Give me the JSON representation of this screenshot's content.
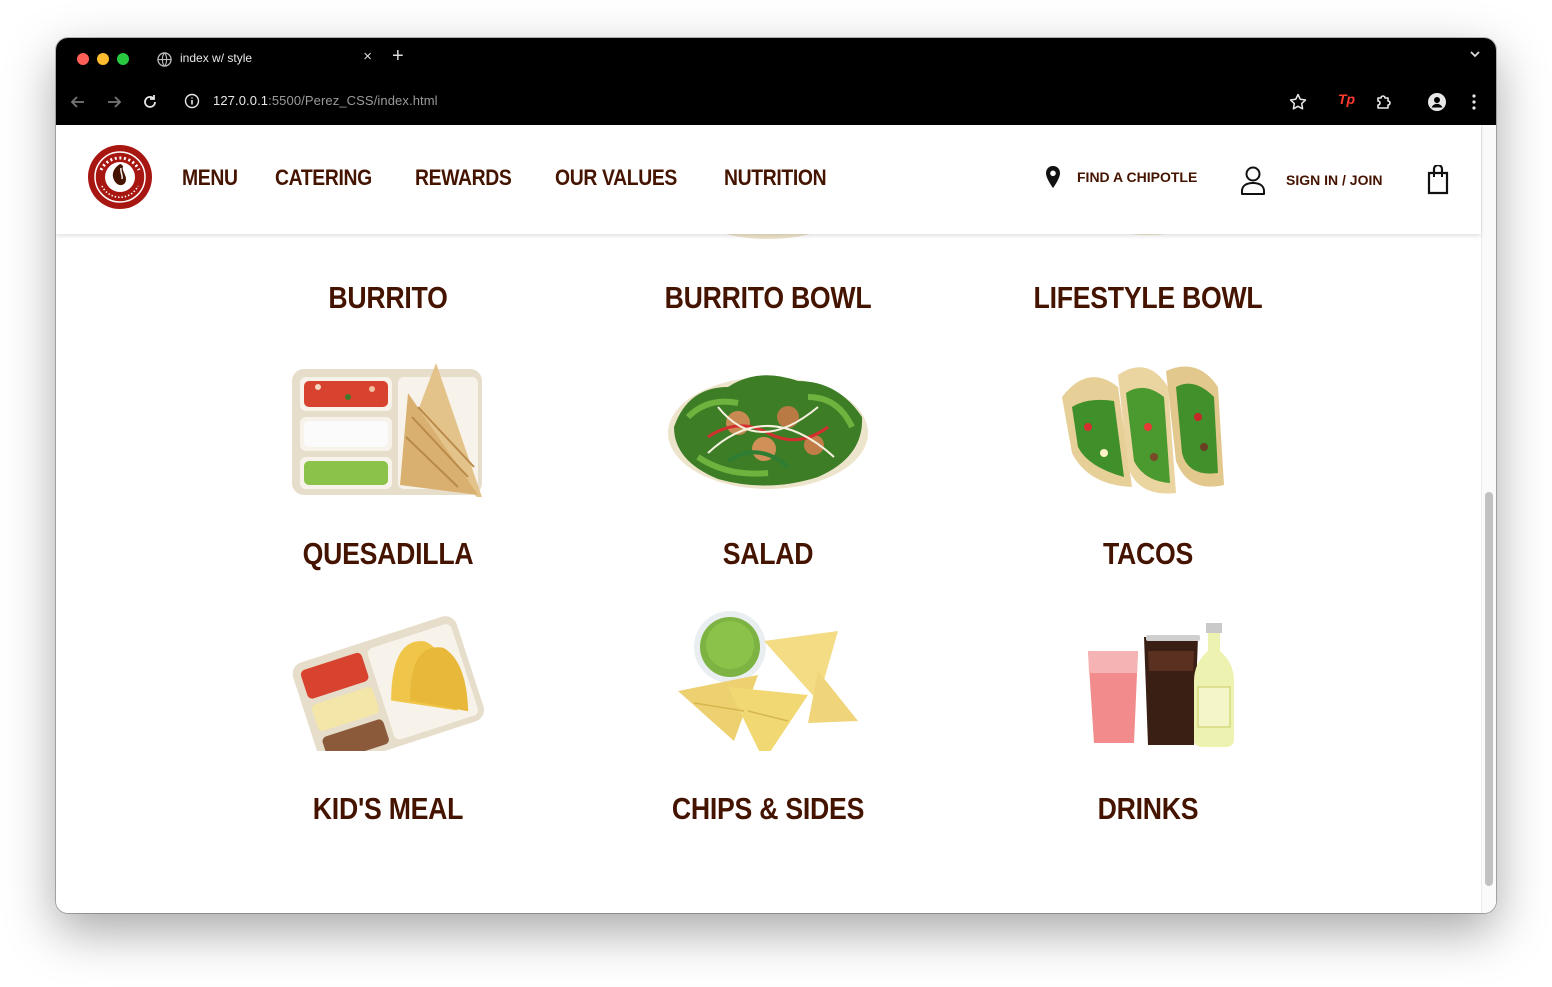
{
  "browser": {
    "tab_title": "index w/ style",
    "new_tab": "+",
    "close_tab": "×",
    "url_host": "127.0.0.1",
    "url_rest": ":5500/Perez_CSS/index.html",
    "extension_label": "Tp"
  },
  "header": {
    "nav": [
      "MENU",
      "CATERING",
      "REWARDS",
      "OUR VALUES",
      "NUTRITION"
    ],
    "find_label": "FIND A CHIPOTLE",
    "signin_label": "SIGN IN / JOIN"
  },
  "menu_items": [
    {
      "name": "BURRITO",
      "icon": "burrito-image"
    },
    {
      "name": "BURRITO BOWL",
      "icon": "burrito-bowl-image"
    },
    {
      "name": "LIFESTYLE BOWL",
      "icon": "lifestyle-bowl-image"
    },
    {
      "name": "QUESADILLA",
      "icon": "quesadilla-image"
    },
    {
      "name": "SALAD",
      "icon": "salad-image"
    },
    {
      "name": "TACOS",
      "icon": "tacos-image"
    },
    {
      "name": "KID'S MEAL",
      "icon": "kids-meal-image"
    },
    {
      "name": "CHIPS & SIDES",
      "icon": "chips-image"
    },
    {
      "name": "DRINKS",
      "icon": "drinks-image"
    }
  ],
  "colors": {
    "brand_brown": "#451400",
    "brand_red": "#a81612",
    "chrome_bg": "#000000"
  }
}
